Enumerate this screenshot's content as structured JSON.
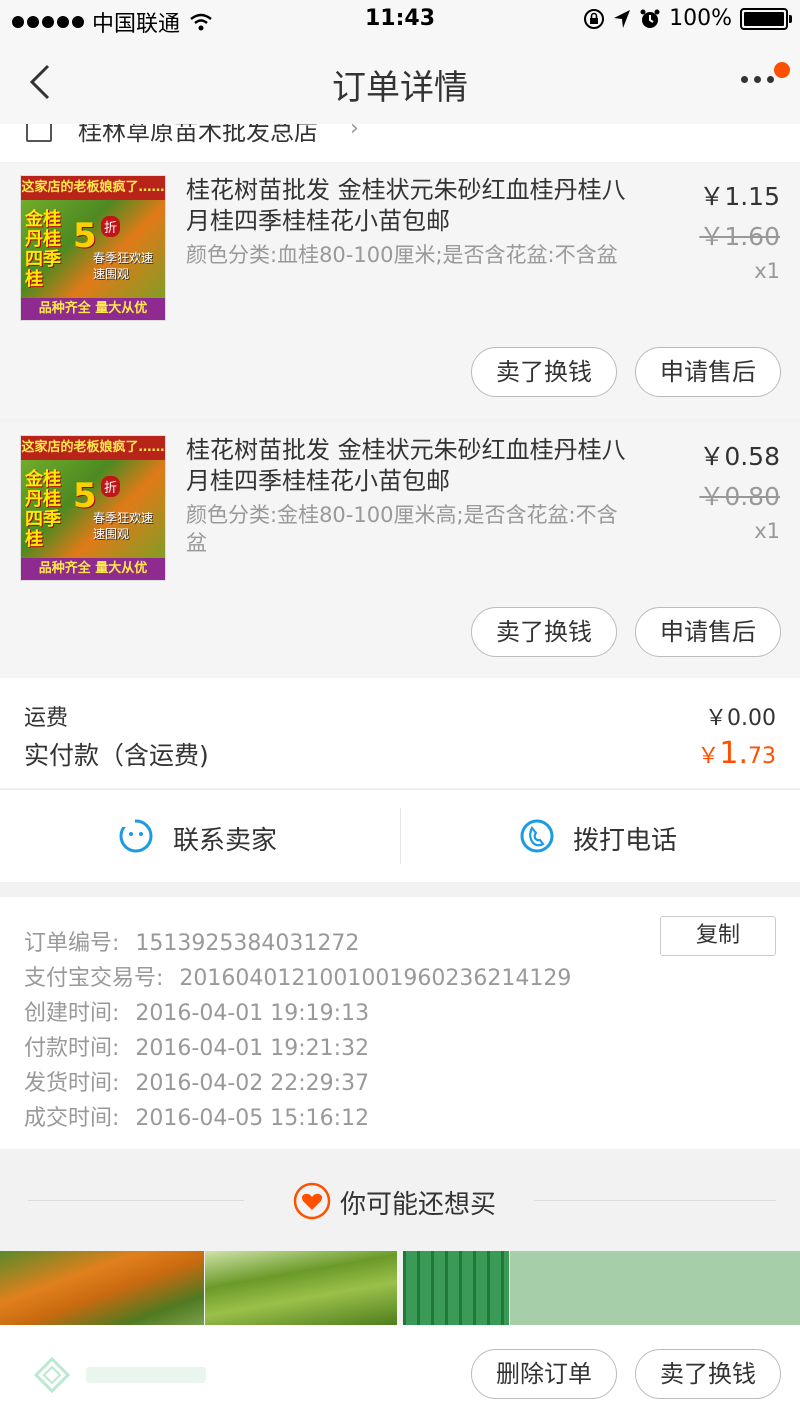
{
  "status_bar": {
    "carrier": "中国联通",
    "time": "11:43",
    "battery": "100%"
  },
  "nav": {
    "title": "订单详情"
  },
  "shop": {
    "name": "桂林草原苗木批发总店"
  },
  "items": [
    {
      "title": "桂花树苗批发 金桂状元朱砂红血桂丹桂八月桂四季桂桂花小苗包邮",
      "sku": "颜色分类:血桂80-100厘米;是否含花盆:不含盆",
      "price": "￥1.15",
      "original_price": "￥1.60",
      "quantity": "x1",
      "thumb": {
        "top_text": "这家店的老板娘疯了……",
        "left_text": "金桂丹桂四季桂",
        "big_number": "5",
        "zhe": "折",
        "promo_lines": "春季狂欢速速围观",
        "bottom_text": "品种齐全 量大从优"
      },
      "btn_sell": "卖了换钱",
      "btn_after": "申请售后"
    },
    {
      "title": "桂花树苗批发 金桂状元朱砂红血桂丹桂八月桂四季桂桂花小苗包邮",
      "sku": "颜色分类:金桂80-100厘米高;是否含花盆:不含盆",
      "price": "￥0.58",
      "original_price": "￥0.80",
      "quantity": "x1",
      "thumb": {
        "top_text": "这家店的老板娘疯了……",
        "left_text": "金桂丹桂四季桂",
        "big_number": "5",
        "zhe": "折",
        "promo_lines": "春季狂欢速速围观",
        "bottom_text": "品种齐全 量大从优"
      },
      "btn_sell": "卖了换钱",
      "btn_after": "申请售后"
    }
  ],
  "totals": {
    "shipping_label": "运费",
    "shipping_value": "￥0.00",
    "paid_label": "实付款（含运费)",
    "paid_currency": "￥",
    "paid_int": "1.",
    "paid_dec": "73"
  },
  "contact": {
    "seller": "联系卖家",
    "phone": "拨打电话"
  },
  "order_info": {
    "order_no_label": "订单编号:",
    "order_no": "1513925384031272",
    "copy": "复制",
    "alipay_label": "支付宝交易号:",
    "alipay_no": "2016040121001001960236214129",
    "created_label": "创建时间:",
    "created": "2016-04-01 19:19:13",
    "paid_label": "付款时间:",
    "paid": "2016-04-01 19:21:32",
    "shipped_label": "发货时间:",
    "shipped": "2016-04-02 22:29:37",
    "done_label": "成交时间:",
    "done": "2016-04-05 15:16:12"
  },
  "recommend": {
    "title": "你可能还想买"
  },
  "bottom": {
    "delete": "删除订单",
    "sell": "卖了换钱"
  },
  "colors": {
    "accent": "#ff5000",
    "icon_blue": "#1c9be5"
  }
}
